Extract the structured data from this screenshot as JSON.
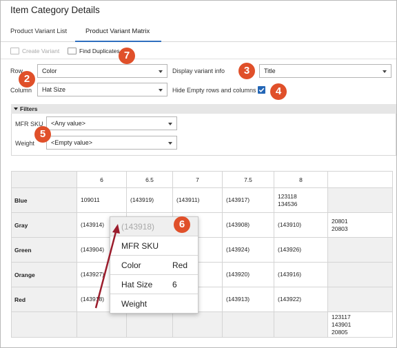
{
  "app": {
    "title": "Item Category Details"
  },
  "tabs": [
    {
      "label": "Product Variant List"
    },
    {
      "label": "Product Variant Matrix"
    }
  ],
  "toolbar": {
    "create_variant": "Create Variant",
    "find_duplicates": "Find Duplicates"
  },
  "form": {
    "row_label": "Row",
    "row_value": "Color",
    "column_label": "Column",
    "column_value": "Hat Size",
    "display_label": "Display variant info",
    "display_value": "Title",
    "hide_empty_label": "Hide Empty rows and columns",
    "hide_empty_checked": true
  },
  "filters": {
    "header": "Filters",
    "mfr_label": "MFR SKU",
    "mfr_value": "<Any value>",
    "weight_label": "Weight",
    "weight_value": "<Empty value>"
  },
  "matrix": {
    "columns": [
      "6",
      "6.5",
      "7",
      "7.5",
      "8",
      ""
    ],
    "rows": [
      {
        "label": "Blue",
        "cells": [
          "109011",
          "(143919)",
          "(143911)",
          "(143917)",
          "123118\n134536",
          ""
        ]
      },
      {
        "label": "Gray",
        "cells": [
          "(143914)",
          "",
          "",
          "(143908)",
          "(143910)",
          "20801\n20803"
        ]
      },
      {
        "label": "Green",
        "cells": [
          "(143904)",
          "",
          "",
          "(143924)",
          "(143926)",
          ""
        ]
      },
      {
        "label": "Orange",
        "cells": [
          "(143927)",
          "",
          "",
          "(143920)",
          "(143916)",
          ""
        ]
      },
      {
        "label": "Red",
        "cells": [
          "(143918)",
          "",
          "",
          "(143913)",
          "(143922)",
          ""
        ]
      },
      {
        "label": "",
        "cells": [
          "",
          "",
          "",
          "",
          "",
          "123117\n143901\n20805"
        ]
      }
    ]
  },
  "popup": {
    "header": "(143918)",
    "mfr_label": "MFR SKU",
    "color_label": "Color",
    "color_value": "Red",
    "size_label": "Hat Size",
    "size_value": "6",
    "weight_label": "Weight"
  },
  "callouts": [
    "2",
    "3",
    "4",
    "5",
    "6",
    "7"
  ],
  "colors": {
    "accent": "#2f6fbf",
    "callout": "#e0502a",
    "arrow": "#9b1c2c",
    "checkbox": "#2366b6"
  }
}
